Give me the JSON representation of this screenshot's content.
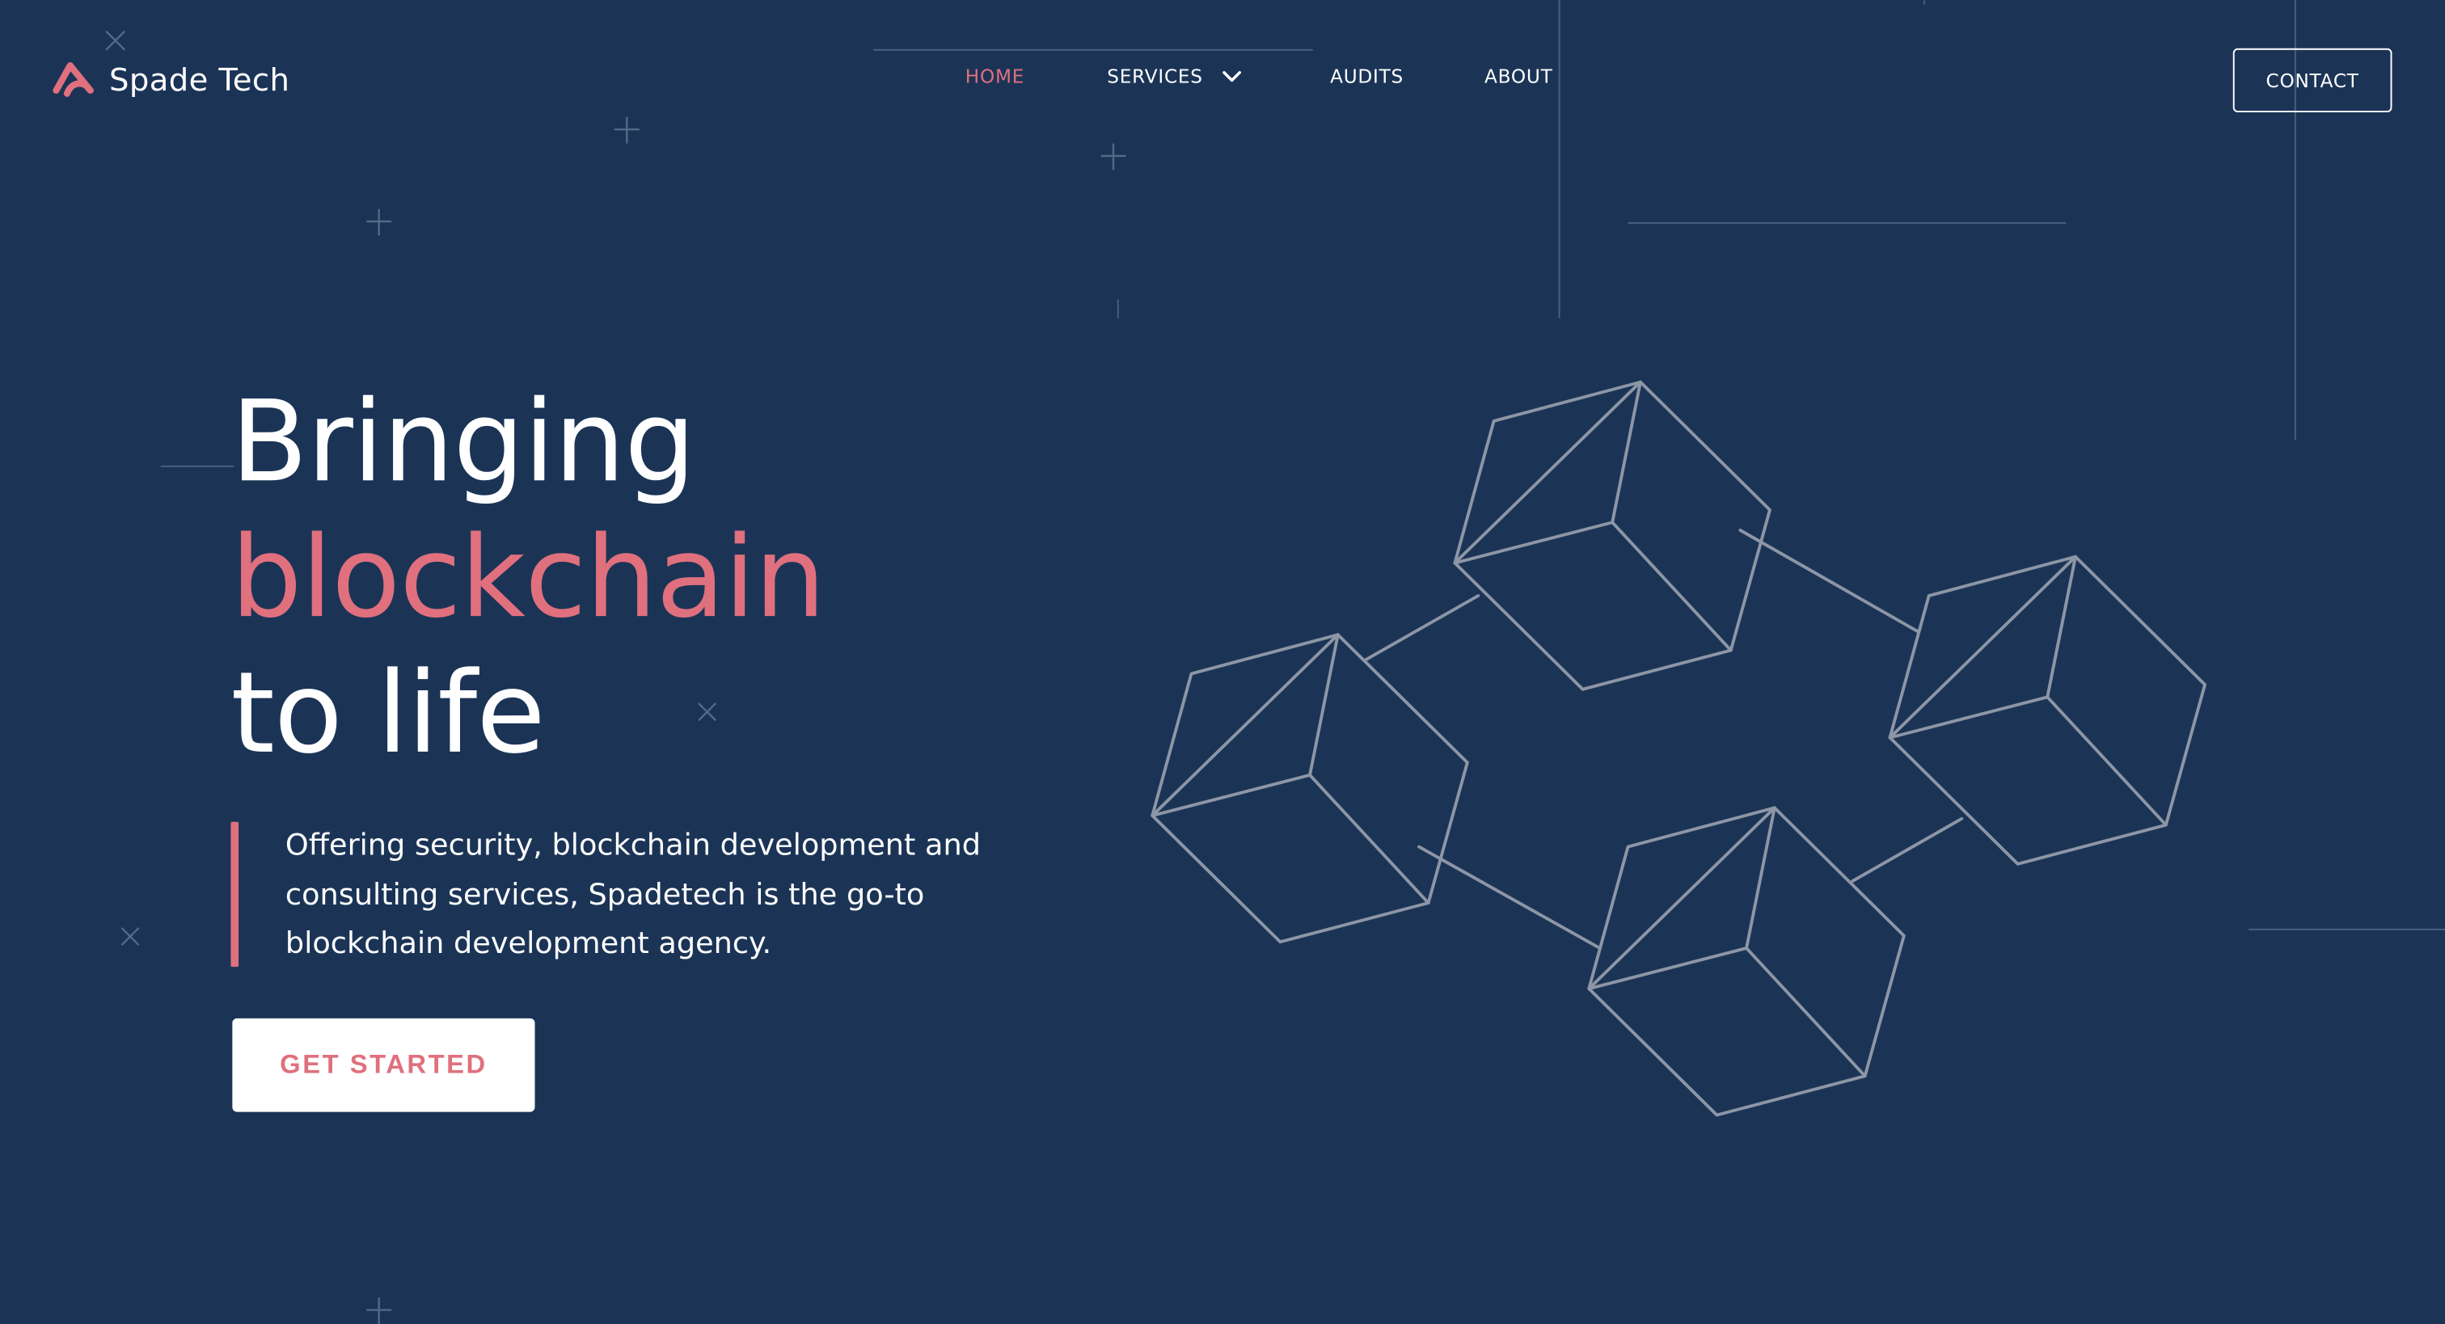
{
  "brand": {
    "name": "Spade Tech",
    "logo_icon": "spade-tech-logo-icon",
    "accent_color": "#e0707e",
    "background_color": "#1b3456"
  },
  "nav": {
    "items": [
      {
        "label": "HOME",
        "active": true
      },
      {
        "label": "SERVICES",
        "has_dropdown": true,
        "dropdown_icon": "chevron-down-icon"
      },
      {
        "label": "AUDITS"
      },
      {
        "label": "ABOUT"
      }
    ],
    "contact_label": "CONTACT"
  },
  "hero": {
    "line1": "Bringing",
    "line2": "blockchain",
    "line3": "to life",
    "description_lines": [
      "Offering security, blockchain development and",
      "consulting services, Spadetech is the go-to",
      "blockchain development agency."
    ],
    "cta_label": "GET STARTED"
  },
  "illustration": {
    "icon": "blockchain-cubes-illustration",
    "cube_count": 4,
    "stroke_color": "#8d96a6"
  }
}
